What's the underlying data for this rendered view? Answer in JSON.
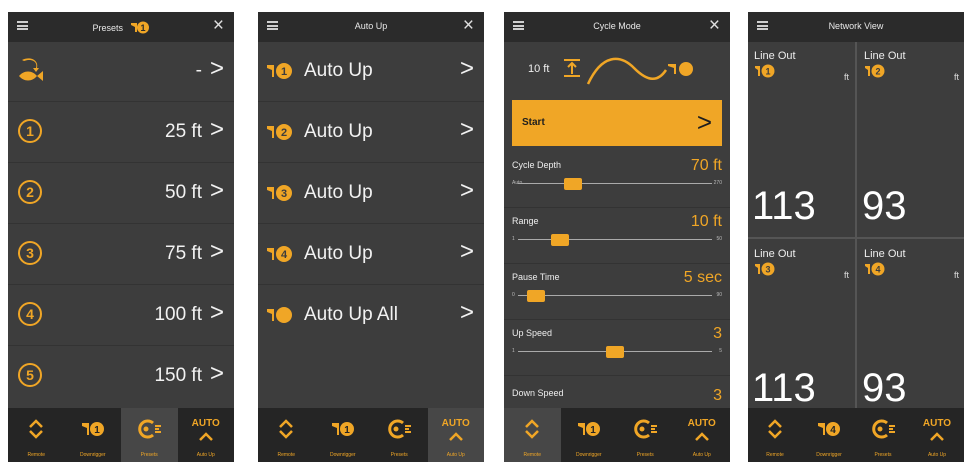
{
  "colors": {
    "accent": "#f0a626",
    "panel": "#3d3d3d",
    "topbar": "#2b2b2b",
    "tabbar": "#252525"
  },
  "tabs": {
    "remote": "Remote",
    "downrigger": "Downrigger",
    "presets": "Presets",
    "auto_up": "Auto Up",
    "auto_word": "AUTO"
  },
  "presets_screen": {
    "title": "Presets",
    "rows": [
      {
        "icon": "fish-return-icon",
        "value": "-"
      },
      {
        "num": "1",
        "value": "25 ft"
      },
      {
        "num": "2",
        "value": "50 ft"
      },
      {
        "num": "3",
        "value": "75 ft"
      },
      {
        "num": "4",
        "value": "100 ft"
      },
      {
        "num": "5",
        "value": "150 ft"
      }
    ]
  },
  "auto_up_screen": {
    "title": "Auto Up",
    "rows": [
      {
        "num": "1",
        "label": "Auto Up"
      },
      {
        "num": "2",
        "label": "Auto Up"
      },
      {
        "num": "3",
        "label": "Auto Up"
      },
      {
        "num": "4",
        "label": "Auto Up"
      },
      {
        "num": "all",
        "label": "Auto Up All"
      }
    ]
  },
  "cycle_screen": {
    "title": "Cycle Mode",
    "depth_label": "10 ft",
    "start_label": "Start",
    "settings": [
      {
        "name": "Cycle Depth",
        "value": "70 ft",
        "min": "Auto",
        "max": "270",
        "position": 0.26
      },
      {
        "name": "Range",
        "value": "10 ft",
        "min": "1",
        "max": "50",
        "position": 0.19
      },
      {
        "name": "Pause Time",
        "value": "5 sec",
        "min": "0",
        "max": "90",
        "position": 0.05
      },
      {
        "name": "Up Speed",
        "value": "3",
        "min": "1",
        "max": "5",
        "position": 0.5
      },
      {
        "name": "Down Speed",
        "value": "3"
      }
    ]
  },
  "network_screen": {
    "title": "Network View",
    "cells": [
      {
        "label": "Line Out",
        "num": "1",
        "unit": "ft",
        "value": "113"
      },
      {
        "label": "Line Out",
        "num": "2",
        "unit": "ft",
        "value": "93"
      },
      {
        "label": "Line Out",
        "num": "3",
        "unit": "ft",
        "value": "113"
      },
      {
        "label": "Line Out",
        "num": "4",
        "unit": "ft",
        "value": "93"
      }
    ]
  }
}
